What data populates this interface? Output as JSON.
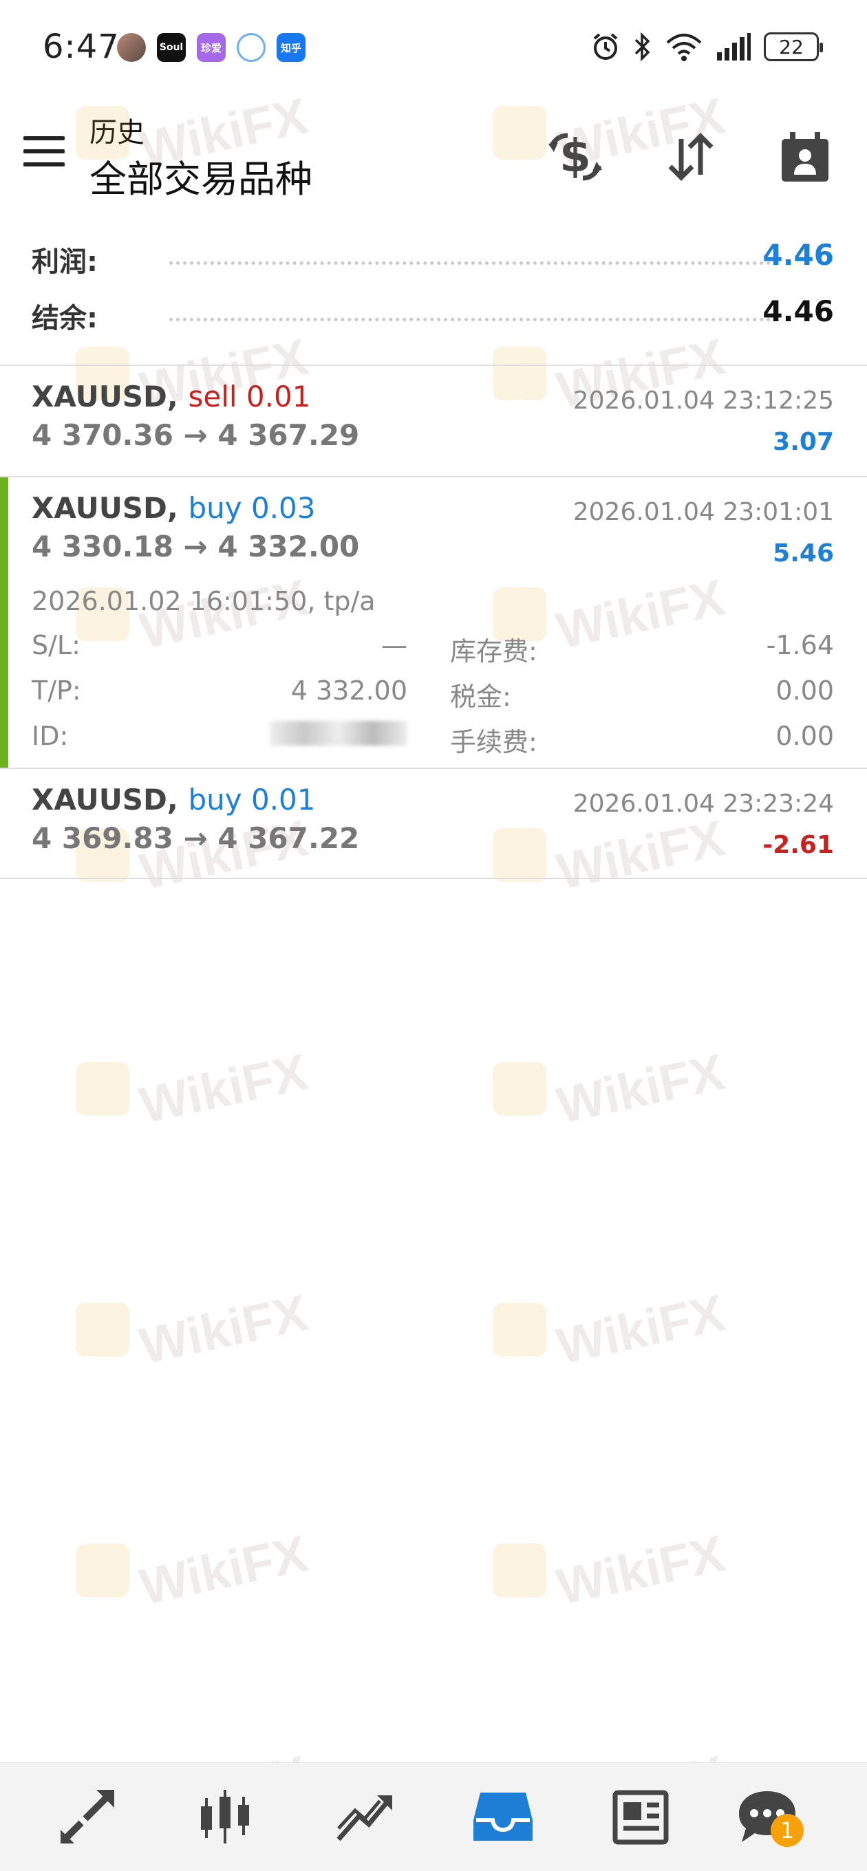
{
  "status_bar": {
    "time": "6:47",
    "apps": [
      "avatar",
      "Soul",
      "珍爱",
      "qq-browser",
      "知乎"
    ],
    "app_labels": {
      "soul": "Soul",
      "zhenai": "珍爱",
      "zhihu": "知乎"
    },
    "battery": "22"
  },
  "header": {
    "title_small": "历史",
    "title_large": "全部交易品种",
    "icons": [
      "dollar-exchange-icon",
      "sort-icon",
      "calendar-person-icon"
    ]
  },
  "summary": {
    "profit_label": "利润:",
    "profit_value": "4.46",
    "balance_label": "结余:",
    "balance_value": "4.46"
  },
  "trades": [
    {
      "symbol": "XAUUSD,",
      "direction": "sell 0.01",
      "prices": "4 370.36 → 4 367.29",
      "time": "2026.01.04 23:12:25",
      "profit": "3.07"
    },
    {
      "symbol": "XAUUSD,",
      "direction": "buy 0.03",
      "prices": "4 330.18 → 4 332.00",
      "time": "2026.01.04 23:01:01",
      "profit": "5.46",
      "open_info": "2026.01.02 16:01:50, tp/a",
      "details": {
        "sl_label": "S/L:",
        "sl_value": "—",
        "tp_label": "T/P:",
        "tp_value": "4 332.00",
        "id_label": "ID:",
        "swap_label": "库存费:",
        "swap_value": "-1.64",
        "tax_label": "税金:",
        "tax_value": "0.00",
        "fee_label": "手续费:",
        "fee_value": "0.00"
      }
    },
    {
      "symbol": "XAUUSD,",
      "direction": "buy 0.01",
      "prices": "4 369.83 → 4 367.22",
      "time": "2026.01.04 23:23:24",
      "profit": "-2.61"
    }
  ],
  "watermark": "WikiFX",
  "bottom_nav": {
    "items": [
      "trade-arrows-icon",
      "quotes-candles-icon",
      "chart-line-icon",
      "history-inbox-icon",
      "news-icon",
      "chat-icon"
    ],
    "chat_badge": "1"
  },
  "colors": {
    "positive": "#1e7fd6",
    "negative": "#c92020",
    "accent_bar": "#6db21f",
    "active_nav": "#1e7fd6"
  }
}
